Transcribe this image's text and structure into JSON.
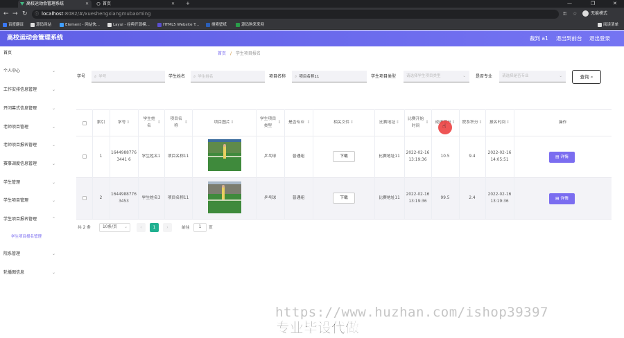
{
  "browser": {
    "tabs": [
      {
        "label": "高校运动会管理系统",
        "active": true
      },
      {
        "label": "首页",
        "active": false
      }
    ],
    "new_tab": "+",
    "url_host": "localhost",
    "url_path": ":8082/#/xueshengxiangmubaoming",
    "profile": "无痕模式",
    "bookmarks": [
      {
        "label": "百度翻译",
        "color": "#3a78f2"
      },
      {
        "label": "源码网站",
        "color": "#222"
      },
      {
        "label": "Element - 网站快...",
        "color": "#409eff"
      },
      {
        "label": "Layui - 经典开源模...",
        "color": "#222"
      },
      {
        "label": "HTML5 Website T...",
        "color": "#5a4fcf"
      },
      {
        "label": "搜索壁纸",
        "color": "#2b5fb8"
      },
      {
        "label": "源码购来来网",
        "color": "#2a9d4a"
      }
    ],
    "reading_list": "阅读清单"
  },
  "header": {
    "title": "高校运动会管理系统",
    "user": "裁判 a1",
    "back_to_admin": "退出到前台",
    "logout": "退出登录",
    "accent": "#6b6af0"
  },
  "sidebar": {
    "items": [
      {
        "label": "首页",
        "chevron": false
      },
      {
        "label": "个人中心",
        "chevron": true
      },
      {
        "label": "工作安排信息管理",
        "chevron": true
      },
      {
        "label": "开闭幕式信息管理",
        "chevron": true
      },
      {
        "label": "老师项目管理",
        "chevron": true
      },
      {
        "label": "老师项目报名管理",
        "chevron": true
      },
      {
        "label": "赛事调度信息管理",
        "chevron": true
      },
      {
        "label": "学生管理",
        "chevron": true
      },
      {
        "label": "学生项目管理",
        "chevron": true
      },
      {
        "label": "学生项目报名管理",
        "chevron": true
      },
      {
        "label": "学生项目报名管理",
        "chevron": false,
        "sub": true
      },
      {
        "label": "院系管理",
        "chevron": true
      },
      {
        "label": "轮播图信息",
        "chevron": true
      }
    ]
  },
  "breadcrumb": {
    "home": "首页",
    "sep": "/",
    "current": "学生项目报名"
  },
  "filters": {
    "student_no_label": "学号",
    "student_no_placeholder": "学号",
    "student_name_label": "学生姓名",
    "student_name_placeholder": "学生姓名",
    "project_name_label": "项目名称",
    "project_name_value": "项目名称11",
    "project_type_label": "学生项目类型",
    "project_type_placeholder": "请选择学生项目类型",
    "major_label": "是否专业",
    "major_placeholder": "请选择是否专业",
    "query_label": "查询"
  },
  "table": {
    "headers": [
      "索引",
      "学号",
      "学生姓名",
      "项目名称",
      "项目图片",
      "学生项目类型",
      "是否专业",
      "相关文件",
      "比赛地址",
      "比赛开始时间",
      "成绩得分",
      "院系积分",
      "报名时间",
      "操作"
    ],
    "rows": [
      {
        "index": "1",
        "student_no": "16449887763441 6",
        "student_name": "学生姓名1",
        "project_name": "项目名称11",
        "project_type": "乒乓球",
        "major": "普通组",
        "file_btn": "下载",
        "address": "比赛地址11",
        "start_time": "2022-02-16 13:19:36",
        "score": "10.5",
        "dept_points": "9.4",
        "signup_time": "2022-02-16 14:05:51",
        "action": "详情"
      },
      {
        "index": "2",
        "student_no": "16449887763453",
        "student_name": "学生姓名3",
        "project_name": "项目名称11",
        "project_type": "乒乓球",
        "major": "普通组",
        "file_btn": "下载",
        "address": "比赛地址11",
        "start_time": "2022-02-16 13:19:36",
        "score": "99.5",
        "dept_points": "2.4",
        "signup_time": "2022-02-16 13:19:36",
        "action": "详情"
      }
    ]
  },
  "pagination": {
    "total": "共 2 条",
    "page_size": "10条/页",
    "current_page": "1",
    "goto": "前往",
    "goto_value": "1",
    "page_unit": "页"
  },
  "overlay": {
    "watermark": "https://www.huzhan.com/ishop39397",
    "promo": "专业毕设代做"
  }
}
